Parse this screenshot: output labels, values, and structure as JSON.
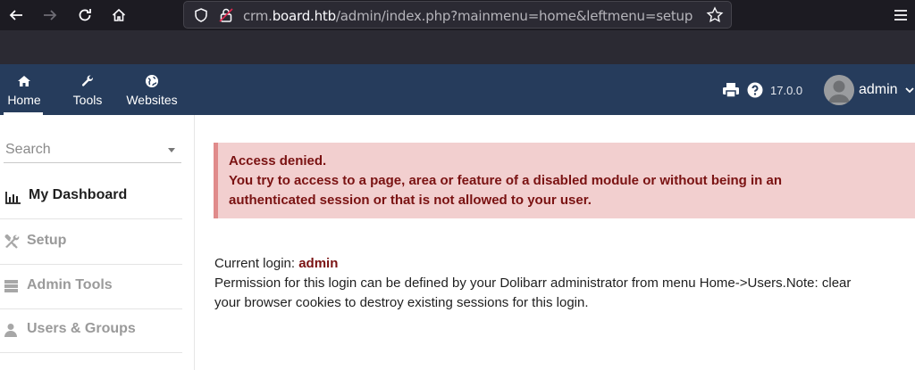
{
  "browser": {
    "url_prefix": "crm.",
    "url_domain": "board.htb",
    "url_path": "/admin/index.php?mainmenu=home&leftmenu=setup"
  },
  "top_menu": [
    {
      "label": "Home",
      "icon": "home-icon",
      "active": true
    },
    {
      "label": "Tools",
      "icon": "wrench-icon",
      "active": false
    },
    {
      "label": "Websites",
      "icon": "globe-icon",
      "active": false
    }
  ],
  "header": {
    "version": "17.0.0",
    "user": "admin"
  },
  "sidebar": {
    "search_placeholder": "Search",
    "items": [
      {
        "label": "My Dashboard",
        "icon": "bar-chart-icon",
        "active": true
      },
      {
        "label": "Setup",
        "icon": "tools-icon",
        "active": false
      },
      {
        "label": "Admin Tools",
        "icon": "server-icon",
        "active": false
      },
      {
        "label": "Users & Groups",
        "icon": "user-icon",
        "active": false
      }
    ]
  },
  "main": {
    "alert_title": "Access denied.",
    "alert_line1": "You try to access to a page, area or feature of a disabled module or without being in an",
    "alert_line2": "authenticated session or that is not allowed to your user.",
    "current_login_label": "Current login: ",
    "current_login_user": "admin",
    "permission_line1": "Permission for this login can be defined by your Dolibarr administrator from menu Home->Users.Note: clear",
    "permission_line2": "your browser cookies to destroy existing sessions for this login."
  },
  "colors": {
    "header_bg": "#263c5c",
    "alert_bg": "#f2cfcf",
    "alert_text": "#7a1212"
  }
}
